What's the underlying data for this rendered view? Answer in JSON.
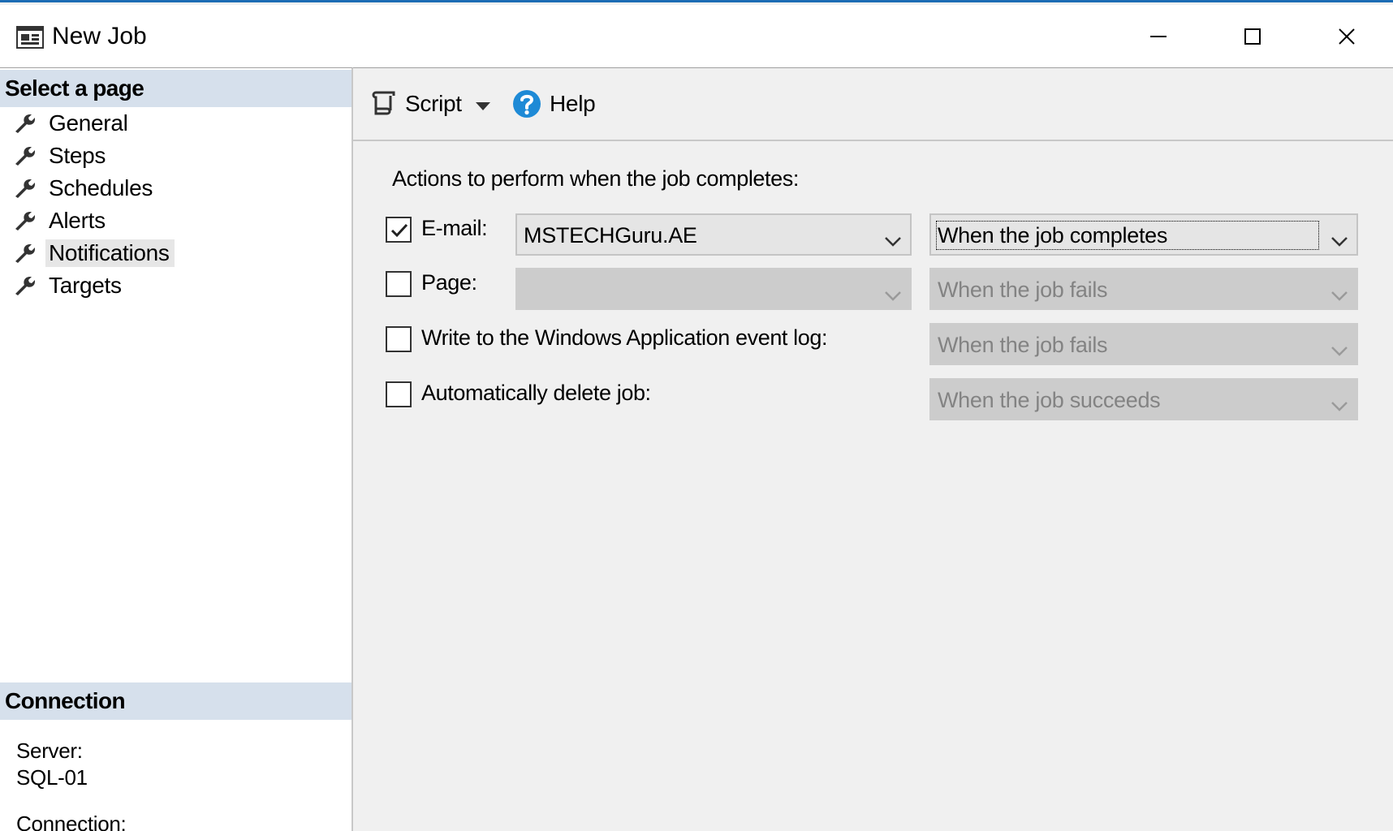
{
  "window": {
    "title": "New Job",
    "icon": "window-icon",
    "controls": {
      "minimize": "minimize-icon",
      "maximize": "maximize-icon",
      "close": "close-icon"
    }
  },
  "sidebar": {
    "header": "Select a page",
    "items": [
      {
        "label": "General",
        "icon": "wrench-icon"
      },
      {
        "label": "Steps",
        "icon": "wrench-icon"
      },
      {
        "label": "Schedules",
        "icon": "wrench-icon"
      },
      {
        "label": "Alerts",
        "icon": "wrench-icon"
      },
      {
        "label": "Notifications",
        "icon": "wrench-icon",
        "selected": true
      },
      {
        "label": "Targets",
        "icon": "wrench-icon"
      }
    ],
    "connection": {
      "header": "Connection",
      "server_label": "Server:",
      "server_value": "SQL-01",
      "connection_label": "Connection:"
    }
  },
  "toolbar": {
    "script_label": "Script",
    "help_label": "Help"
  },
  "notifications": {
    "actions_label": "Actions to perform when the job completes:",
    "email": {
      "label": "E-mail:",
      "checked": true,
      "operator": "MSTECHGuru.AE",
      "condition": "When the job completes"
    },
    "page": {
      "label": "Page:",
      "checked": false,
      "operator": "",
      "condition": "When the job fails"
    },
    "eventlog": {
      "label": "Write to the Windows Application event log:",
      "checked": false,
      "condition": "When the job fails"
    },
    "delete": {
      "label": "Automatically delete job:",
      "checked": false,
      "condition": "When the job succeeds"
    }
  },
  "colors": {
    "title_accent": "#1c6cb4",
    "section_header_bg": "#d6e0ec",
    "help_icon_blue": "#1e8ad6"
  }
}
